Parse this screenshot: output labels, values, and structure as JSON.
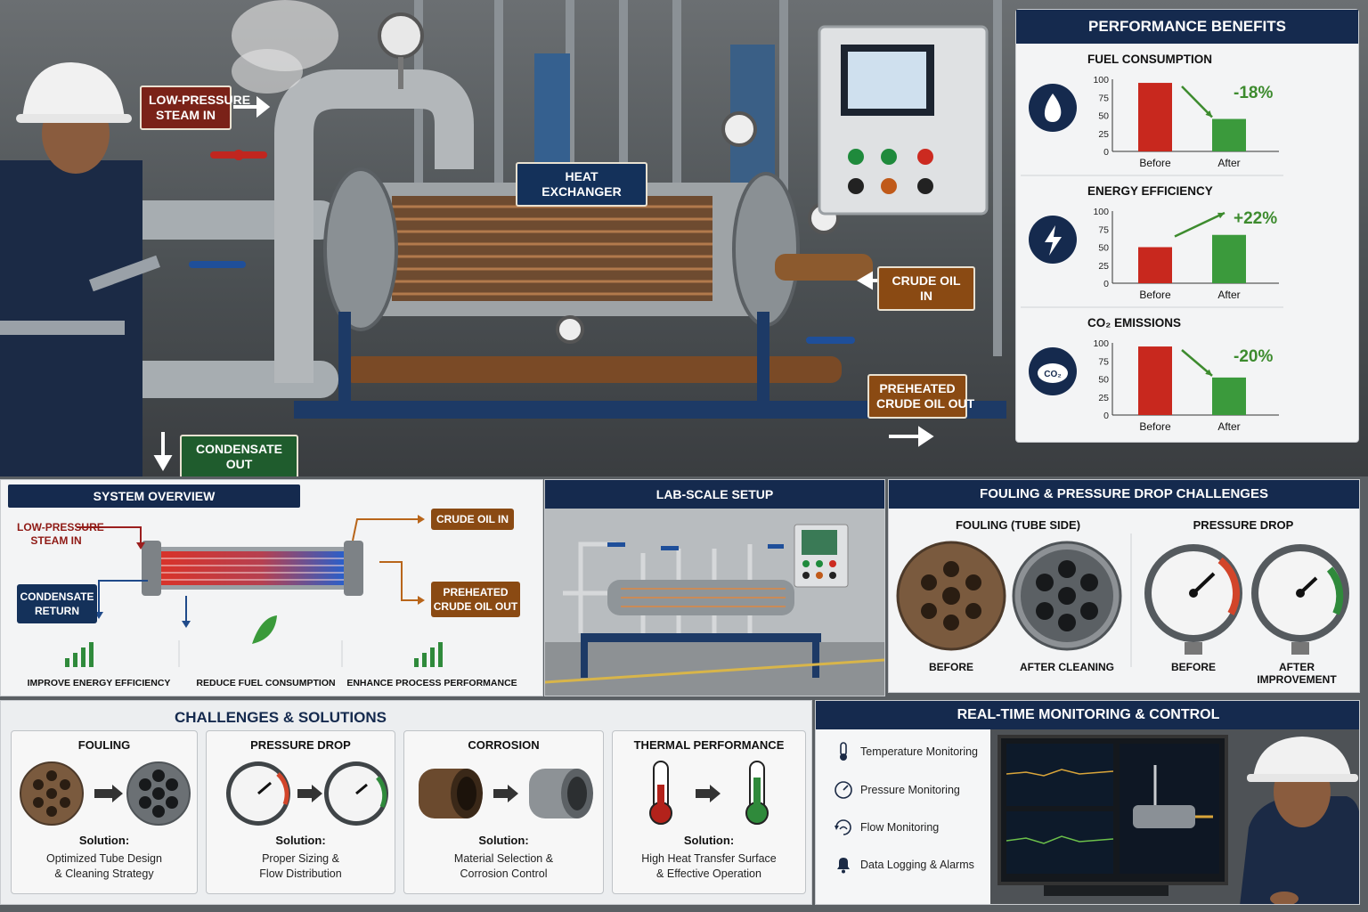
{
  "photo_labels": {
    "steam_in": "LOW-PRESSURE\nSTEAM IN",
    "heat_exchanger": "HEAT EXCHANGER",
    "crude_in": "CRUDE OIL IN",
    "preheated_out": "PREHEATED\nCRUDE OIL OUT",
    "condensate_out": "CONDENSATE OUT"
  },
  "performance": {
    "title": "PERFORMANCE BENEFITS",
    "charts": [
      {
        "title": "FUEL CONSUMPTION",
        "icon": "flame-icon",
        "before": 95,
        "after": 45,
        "change": "-18%",
        "direction": "down"
      },
      {
        "title": "ENERGY EFFICIENCY",
        "icon": "bolt-icon",
        "before": 50,
        "after": 67,
        "change": "+22%",
        "direction": "up"
      },
      {
        "title": "CO₂ EMISSIONS",
        "icon": "co2-cloud-icon",
        "before": 95,
        "after": 52,
        "change": "-20%",
        "direction": "down"
      }
    ],
    "ticks": [
      "100",
      "75",
      "50",
      "25",
      "0"
    ],
    "x_before": "Before",
    "x_after": "After",
    "colors": {
      "before": "#c8281e",
      "after": "#3b9a3c",
      "change": "#3d8b2e"
    }
  },
  "system_overview": {
    "title": "SYSTEM OVERVIEW",
    "steam_in": "LOW-PRESSURE\nSTEAM IN",
    "condensate": "CONDENSATE\nRETURN",
    "crude_in": "CRUDE OIL IN",
    "preheated": "PREHEATED\nCRUDE OIL OUT",
    "goals": [
      "IMPROVE ENERGY EFFICIENCY",
      "REDUCE FUEL CONSUMPTION",
      "ENHANCE PROCESS PERFORMANCE"
    ]
  },
  "lab": {
    "title": "LAB-SCALE SETUP"
  },
  "fouling": {
    "title": "FOULING & PRESSURE DROP CHALLENGES",
    "fouling_sub": "FOULING (TUBE SIDE)",
    "pressure_sub": "PRESSURE DROP",
    "captions": [
      "BEFORE",
      "AFTER CLEANING",
      "BEFORE",
      "AFTER IMPROVEMENT"
    ]
  },
  "challenges": {
    "title": "CHALLENGES & SOLUTIONS",
    "solution_label": "Solution:",
    "cards": [
      {
        "title": "FOULING",
        "text": "Optimized Tube Design\n& Cleaning Strategy"
      },
      {
        "title": "PRESSURE DROP",
        "text": "Proper Sizing &\nFlow Distribution"
      },
      {
        "title": "CORROSION",
        "text": "Material Selection &\nCorrosion Control"
      },
      {
        "title": "THERMAL PERFORMANCE",
        "text": "High Heat Transfer Surface\n& Effective Operation"
      }
    ]
  },
  "monitoring": {
    "title": "REAL-TIME MONITORING & CONTROL",
    "items": [
      {
        "label": "Temperature Monitoring",
        "icon": "thermometer-icon"
      },
      {
        "label": "Pressure Monitoring",
        "icon": "gauge-icon"
      },
      {
        "label": "Flow Monitoring",
        "icon": "flow-icon"
      },
      {
        "label": "Data Logging & Alarms",
        "icon": "bell-icon"
      }
    ]
  }
}
